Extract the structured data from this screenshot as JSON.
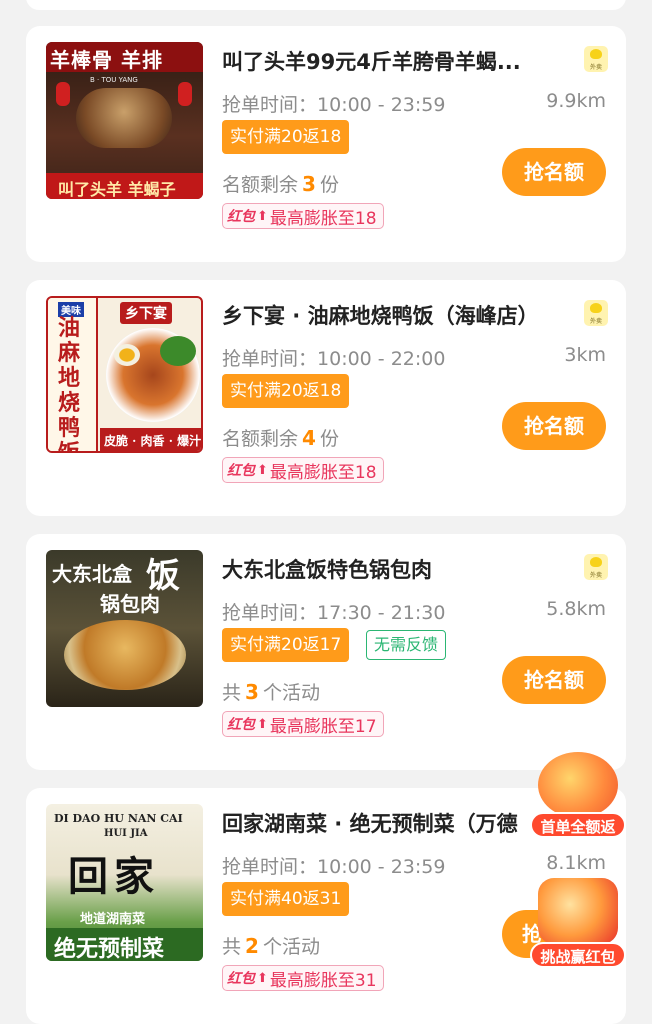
{
  "deals": [
    {
      "title": "叫了头羊99元4斤羊胯骨羊蝎...",
      "time_label": "抢单时间：",
      "time_range": "10:00 - 23:59",
      "distance": "9.9km",
      "rebate": "实付满20返18",
      "quota_prefix": "名额剩余",
      "quota_num": "3",
      "quota_suffix": "份",
      "button": "抢名额",
      "redpack_tag": "红包",
      "redpack_text": "最高膨胀至18",
      "brand_tag": "外卖",
      "image_text": [
        "羊棒骨 羊排",
        "B · TOU YANG",
        "叫了头羊 羊蝎子"
      ]
    },
    {
      "title": "乡下宴 · 油麻地烧鸭饭（海峰店）",
      "time_label": "抢单时间：",
      "time_range": "10:00 - 22:00",
      "distance": "3km",
      "rebate": "实付满20返18",
      "quota_prefix": "名额剩余",
      "quota_num": "4",
      "quota_suffix": "份",
      "button": "抢名额",
      "redpack_tag": "红包",
      "redpack_text": "最高膨胀至18",
      "brand_tag": "外卖",
      "image_text": [
        "油麻地烧鸭饭",
        "乡下宴",
        "皮脆 · 肉香 · 爆汁",
        "美味"
      ]
    },
    {
      "title": "大东北盒饭特色锅包肉",
      "time_label": "抢单时间：",
      "time_range": "17:30 - 21:30",
      "distance": "5.8km",
      "rebate": "实付满20返17",
      "extra_tag": "无需反馈",
      "quota_prefix": "共",
      "quota_num": "3",
      "quota_suffix": "个活动",
      "button": "抢名额",
      "redpack_tag": "红包",
      "redpack_text": "最高膨胀至17",
      "brand_tag": "外卖",
      "image_text": [
        "大东北盒",
        "饭",
        "锅包肉"
      ]
    },
    {
      "title": "回家湖南菜 · 绝无预制菜（万德",
      "time_label": "抢单时间：",
      "time_range": "10:00 - 23:59",
      "distance": "8.1km",
      "rebate": "实付满40返31",
      "quota_prefix": "共",
      "quota_num": "2",
      "quota_suffix": "个活动",
      "button": "抢",
      "redpack_tag": "红包",
      "redpack_text": "最高膨胀至31",
      "image_text": [
        "DI DAO HU NAN CAI",
        "HUI JIA",
        "回家",
        "地道湖南菜",
        "绝无预制菜"
      ]
    }
  ],
  "floating": {
    "first_order": "首单全额返",
    "challenge": "挑战赢红包"
  },
  "colors": {
    "accent": "#ff9b1a",
    "redpack": "#e8365d",
    "green": "#2bb673"
  }
}
